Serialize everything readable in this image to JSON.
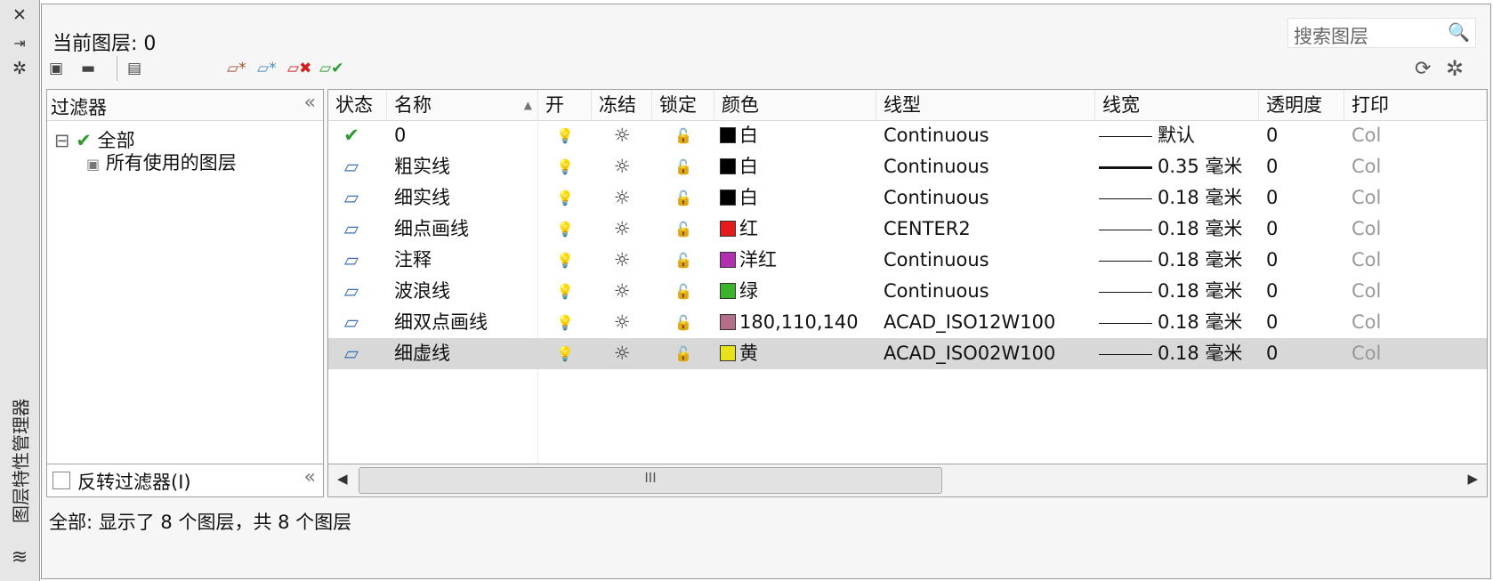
{
  "side": {
    "close_icon": "✕",
    "pin_icon": "⇥",
    "settings_icon": "✲",
    "vertical_title": "图层特性管理器",
    "layers_icon": "≋"
  },
  "header": {
    "current_layer_label": "当前图层: 0",
    "search_placeholder": "搜索图层",
    "search_icon": "🔍",
    "refresh_icon": "⟳",
    "gear_icon": "✲"
  },
  "toolbar": {
    "new_property_filter_icon": "▣",
    "new_group_filter_icon": "▬",
    "layer_state_manager_icon": "▤",
    "new_layer_icon": "▱*",
    "new_layer_vp_frozen_icon": "▱*",
    "delete_layer_icon": "▱✖",
    "set_current_icon": "▱✔"
  },
  "filter_panel": {
    "title": "过滤器",
    "collapse_icon": "«",
    "tree": [
      {
        "expander": "⊟",
        "icon": "✔",
        "label": "全部"
      },
      {
        "icon": "▣",
        "label": "所有使用的图层"
      }
    ],
    "invert_label": "反转过滤器(I)",
    "invert_collapse_icon": "«"
  },
  "table": {
    "columns": [
      "状态",
      "名称",
      "开",
      "冻结",
      "锁定",
      "颜色",
      "线型",
      "线宽",
      "透明度",
      "打印"
    ],
    "sort_icon": "▲",
    "icons": {
      "status_current": "✔",
      "status_normal": "▱",
      "on": "💡",
      "thaw": "☼",
      "unlock": "🔓"
    },
    "rows": [
      {
        "name": "0",
        "color_name": "白",
        "color_hex": "#000000",
        "linetype": "Continuous",
        "lineweight": "默认",
        "thick": false,
        "transparency": "0",
        "plot": "Col",
        "current": true
      },
      {
        "name": "粗实线",
        "color_name": "白",
        "color_hex": "#000000",
        "linetype": "Continuous",
        "lineweight": "0.35 毫米",
        "thick": true,
        "transparency": "0",
        "plot": "Col",
        "current": false
      },
      {
        "name": "细实线",
        "color_name": "白",
        "color_hex": "#000000",
        "linetype": "Continuous",
        "lineweight": "0.18 毫米",
        "thick": false,
        "transparency": "0",
        "plot": "Col",
        "current": false
      },
      {
        "name": "细点画线",
        "color_name": "红",
        "color_hex": "#e31b1b",
        "linetype": "CENTER2",
        "lineweight": "0.18 毫米",
        "thick": false,
        "transparency": "0",
        "plot": "Col",
        "current": false
      },
      {
        "name": "注释",
        "color_name": "洋红",
        "color_hex": "#b030b0",
        "linetype": "Continuous",
        "lineweight": "0.18 毫米",
        "thick": false,
        "transparency": "0",
        "plot": "Col",
        "current": false
      },
      {
        "name": "波浪线",
        "color_name": "绿",
        "color_hex": "#3bb32d",
        "linetype": "Continuous",
        "lineweight": "0.18 毫米",
        "thick": false,
        "transparency": "0",
        "plot": "Col",
        "current": false
      },
      {
        "name": "细双点画线",
        "color_name": "180,110,140",
        "color_hex": "#b46e8c",
        "linetype": "ACAD_ISO12W100",
        "lineweight": "0.18 毫米",
        "thick": false,
        "transparency": "0",
        "plot": "Col",
        "current": false
      },
      {
        "name": "细虚线",
        "color_name": "黄",
        "color_hex": "#e8e21c",
        "linetype": "ACAD_ISO02W100",
        "lineweight": "0.18 毫米",
        "thick": false,
        "transparency": "0",
        "plot": "Col",
        "current": false,
        "selected": true
      }
    ]
  },
  "scrollbar": {
    "left_arrow": "◀",
    "right_arrow": "▶",
    "grip": "III"
  },
  "status": "全部: 显示了 8 个图层，共 8 个图层"
}
